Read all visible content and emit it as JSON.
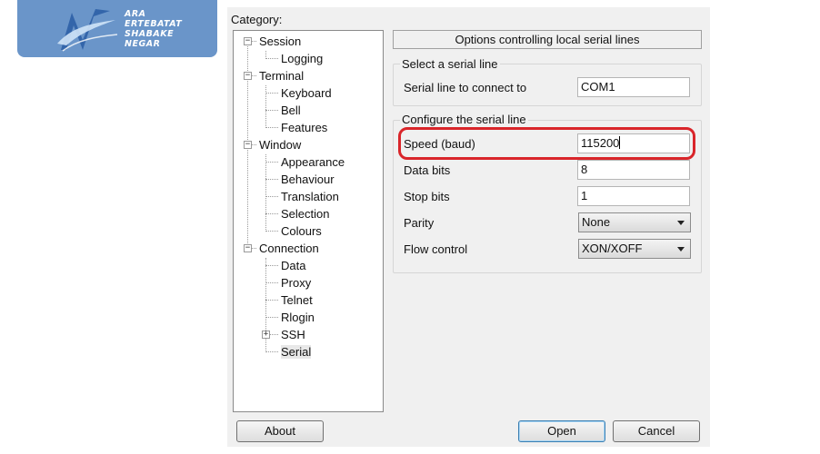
{
  "watermark": {
    "lines": [
      "ARA",
      "ERTEBATAT",
      "SHABAKE",
      "NEGAR"
    ],
    "color": "#6a95c9"
  },
  "category_label": "Category:",
  "tree": [
    {
      "label": "Session",
      "level": 0,
      "expander": "−"
    },
    {
      "label": "Logging",
      "level": 1
    },
    {
      "label": "Terminal",
      "level": 0,
      "expander": "−"
    },
    {
      "label": "Keyboard",
      "level": 1
    },
    {
      "label": "Bell",
      "level": 1
    },
    {
      "label": "Features",
      "level": 1
    },
    {
      "label": "Window",
      "level": 0,
      "expander": "−"
    },
    {
      "label": "Appearance",
      "level": 1
    },
    {
      "label": "Behaviour",
      "level": 1
    },
    {
      "label": "Translation",
      "level": 1
    },
    {
      "label": "Selection",
      "level": 1
    },
    {
      "label": "Colours",
      "level": 1
    },
    {
      "label": "Connection",
      "level": 0,
      "expander": "−"
    },
    {
      "label": "Data",
      "level": 1
    },
    {
      "label": "Proxy",
      "level": 1
    },
    {
      "label": "Telnet",
      "level": 1
    },
    {
      "label": "Rlogin",
      "level": 1
    },
    {
      "label": "SSH",
      "level": 1,
      "expander": "+"
    },
    {
      "label": "Serial",
      "level": 1,
      "selected": true
    }
  ],
  "panel": {
    "header": "Options controlling local serial lines",
    "select_group": {
      "title": "Select a serial line",
      "line_label": "Serial line to connect to",
      "line_value": "COM1"
    },
    "config_group": {
      "title": "Configure the serial line",
      "speed_label": "Speed (baud)",
      "speed_value": "115200",
      "data_bits_label": "Data bits",
      "data_bits_value": "8",
      "stop_bits_label": "Stop bits",
      "stop_bits_value": "1",
      "parity_label": "Parity",
      "parity_value": "None",
      "flow_label": "Flow control",
      "flow_value": "XON/XOFF"
    }
  },
  "buttons": {
    "about": "About",
    "open": "Open",
    "cancel": "Cancel"
  },
  "colors": {
    "highlight": "#d9252a",
    "dialog_bg": "#f0f0f0"
  }
}
